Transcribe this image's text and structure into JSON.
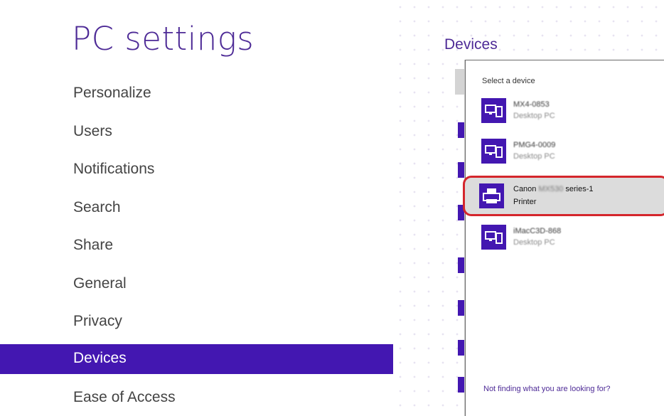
{
  "app": {
    "title": "PC settings"
  },
  "nav": {
    "items": [
      {
        "label": "Personalize",
        "selected": false
      },
      {
        "label": "Users",
        "selected": false
      },
      {
        "label": "Notifications",
        "selected": false
      },
      {
        "label": "Search",
        "selected": false
      },
      {
        "label": "Share",
        "selected": false
      },
      {
        "label": "General",
        "selected": false
      },
      {
        "label": "Privacy",
        "selected": false
      },
      {
        "label": "Devices",
        "selected": true
      },
      {
        "label": "Ease of Access",
        "selected": false
      }
    ]
  },
  "main": {
    "section_title": "Devices"
  },
  "flyout": {
    "title": "Select a device",
    "devices": [
      {
        "name": "MX4-0853",
        "type": "Desktop PC",
        "icon": "desktop-pc-icon"
      },
      {
        "name": "PMG4-0009",
        "type": "Desktop PC",
        "icon": "desktop-pc-icon"
      },
      {
        "name_prefix": "Canon",
        "name_redacted": "MX530",
        "name_suffix": "series-1",
        "type": "Printer",
        "icon": "printer-icon",
        "highlighted": true
      },
      {
        "name": "iMacC3D-868",
        "type": "Desktop PC",
        "icon": "desktop-pc-icon"
      }
    ],
    "help_link": "Not finding what you are looking for?"
  },
  "colors": {
    "accent": "#4317b1",
    "title": "#4d2a96",
    "highlight_border": "#d4262c"
  }
}
